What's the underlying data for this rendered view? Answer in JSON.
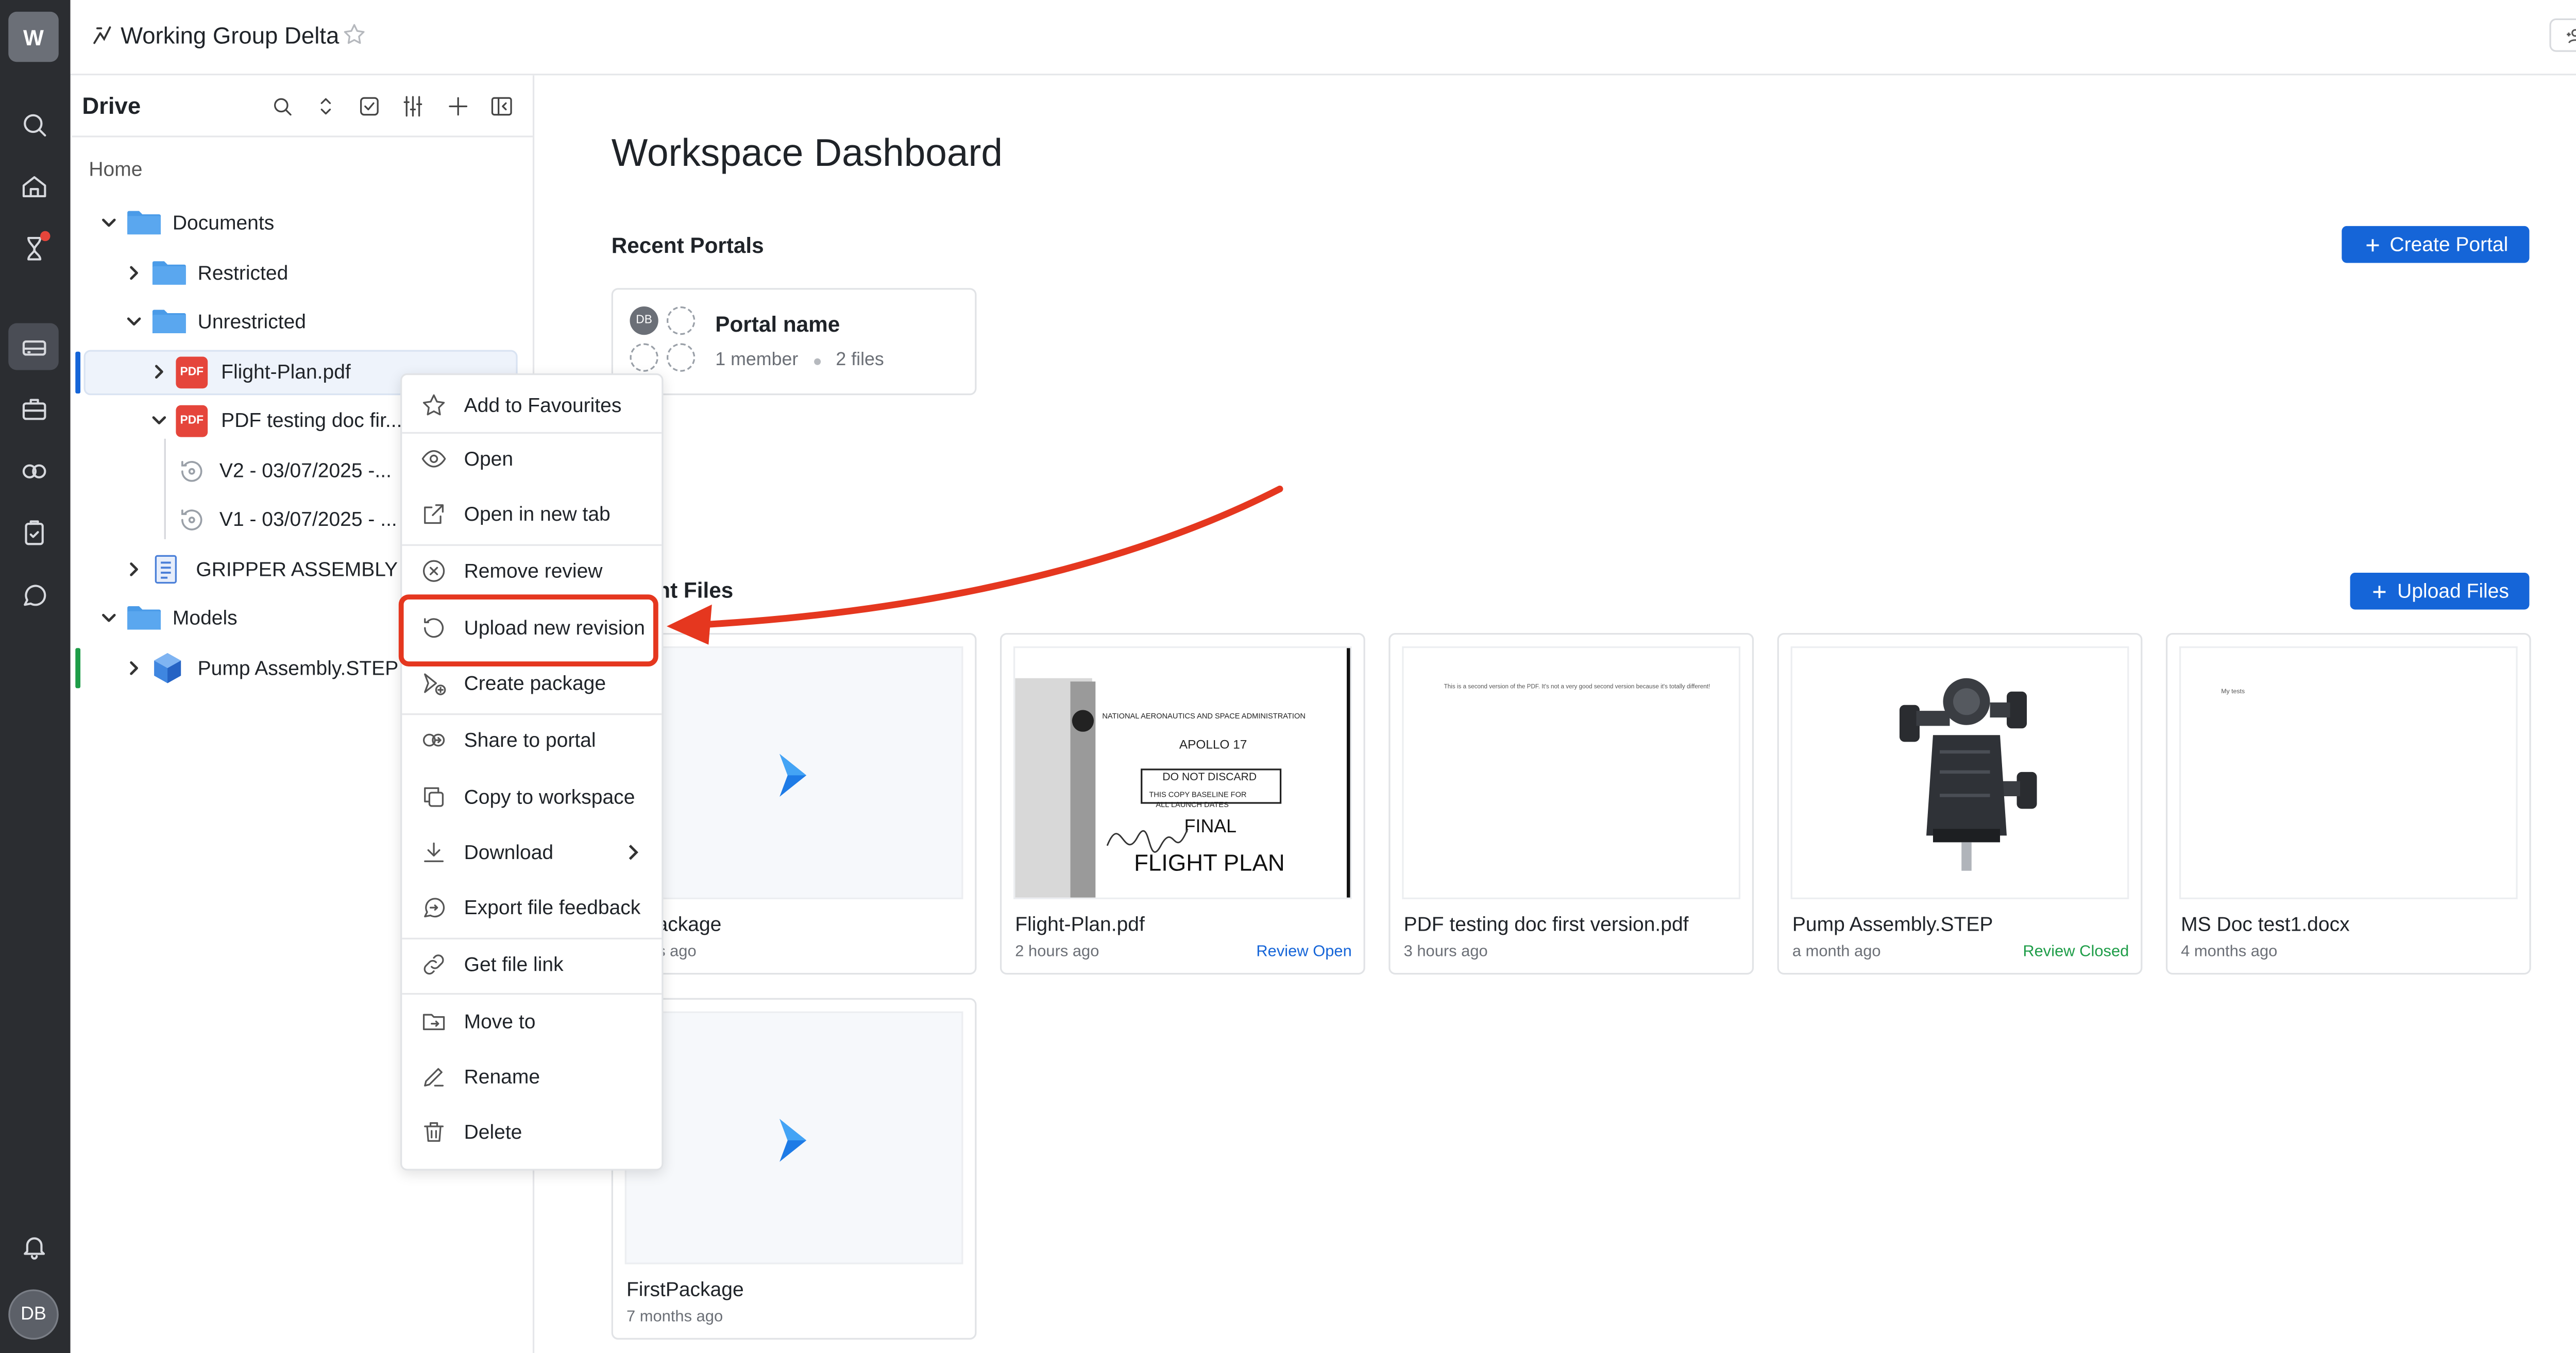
{
  "workspace": {
    "initial": "W",
    "name": "Working Group Delta",
    "members_count": "1"
  },
  "user": {
    "initials": "DB"
  },
  "rail": {
    "icons": [
      "search-icon",
      "home-icon",
      "flask-icon",
      "drive-icon",
      "briefcase-icon",
      "portal-icon",
      "checklist-icon",
      "chat-icon",
      "bell-icon"
    ]
  },
  "drive": {
    "title": "Drive",
    "home": "Home",
    "tree": {
      "documents": "Documents",
      "restricted": "Restricted",
      "unrestricted": "Unrestricted",
      "flight_plan": "Flight-Plan.pdf",
      "pdf_testing": "PDF testing doc fir...",
      "v2": "V2 - 03/07/2025 -...",
      "v1": "V1 - 03/07/2025 - ...",
      "gripper": "GRIPPER ASSEMBLY ...",
      "models": "Models",
      "pump": "Pump Assembly.STEP",
      "pdf_badge": "PDF"
    }
  },
  "context_menu": {
    "items": [
      "Add to Favourites",
      "Open",
      "Open in new tab",
      "Remove review",
      "Upload new revision",
      "Create package",
      "Share to portal",
      "Copy to workspace",
      "Download",
      "Export file feedback",
      "Get file link",
      "Move to",
      "Rename",
      "Delete"
    ]
  },
  "main": {
    "title": "Workspace Dashboard",
    "recent_portals": "Recent Portals",
    "create_portal": "Create Portal",
    "portal": {
      "name": "Portal name",
      "members": "1 member",
      "files": "2 files",
      "avatar": "DB"
    },
    "recent_files": "ent Files",
    "upload_files": "Upload Files",
    "files": [
      {
        "name": "a Package",
        "time": "nutes ago",
        "status": ""
      },
      {
        "name": "Flight-Plan.pdf",
        "time": "2 hours ago",
        "status": "Review Open"
      },
      {
        "name": "PDF testing doc first version.pdf",
        "time": "3 hours ago",
        "status": ""
      },
      {
        "name": "Pump Assembly.STEP",
        "time": "a month ago",
        "status": "Review Closed"
      },
      {
        "name": "MS Doc test1.docx",
        "time": "4 months ago",
        "status": ""
      },
      {
        "name": "FirstPackage",
        "time": "7 months ago",
        "status": ""
      }
    ],
    "thumbs": {
      "flight_plan": {
        "line1": "NATIONAL AERONAUTICS AND SPACE ADMINISTRATION",
        "line2": "APOLLO 17",
        "line3": "DO NOT DISCARD",
        "line4": "THIS COPY BASELINE FOR",
        "line5": "ALL LAUNCH DATES",
        "line6": "FINAL",
        "line7": "FLIGHT PLAN"
      },
      "pdf_testing": "This is a second version of the PDF. It's not a very good second version because it's totally different!",
      "ms_doc": "My tests"
    }
  },
  "colors": {
    "accent": "#1565d8",
    "annotation": "#e5371f",
    "review_open": "#1565d8",
    "review_closed": "#1e9d48",
    "pdf": "#e5453b",
    "folder": "#4a9be8"
  }
}
